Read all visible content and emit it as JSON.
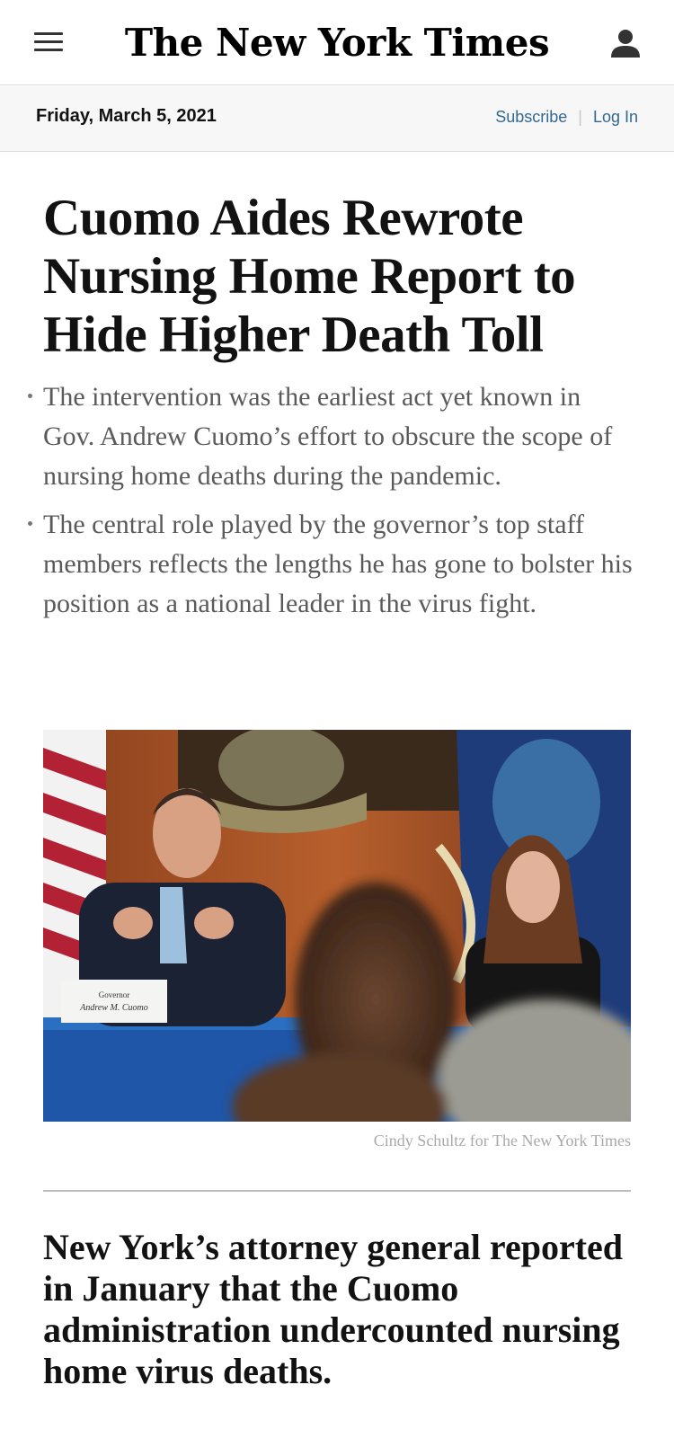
{
  "header": {
    "logo_text": "The New York Times",
    "date": "Friday, March 5, 2021",
    "subscribe_label": "Subscribe",
    "separator": "|",
    "login_label": "Log In",
    "menu_icon": "hamburger-menu-icon",
    "user_icon": "user-account-icon"
  },
  "article": {
    "headline": "Cuomo Aides Rewrote Nursing Home Report to Hide Higher Death Toll",
    "summary": [
      "The intervention was the earliest act yet known in Gov. Andrew Cuomo’s effort to obscure the scope of nursing home deaths during the pandemic.",
      "The central role played by the governor’s top staff members reflects the lengths he has gone to bolster his position as a national leader in the virus fight."
    ],
    "photo": {
      "placard_title": "Governor",
      "placard_name": "Andrew M. Cuomo",
      "credit": "Cindy Schultz for The New York Times"
    },
    "lead_paragraph": "New York’s attorney general reported in January that the Cuomo administration undercounted nursing home virus deaths."
  },
  "colors": {
    "link": "#326891",
    "text": "#121212",
    "summary": "#5a5a5a",
    "date_bar": "#f7f7f7"
  }
}
